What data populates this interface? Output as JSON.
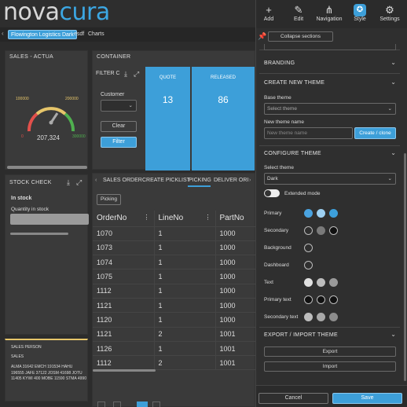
{
  "app": {
    "logo_part1": "nova",
    "logo_part2": "cura"
  },
  "navbar": {
    "chip1": "Flowington Logistics Dark",
    "chip2": "esdf",
    "chip3": "Charts"
  },
  "sales": {
    "title": "SALES - ACTUA",
    "min": "0",
    "low": "100000",
    "high": "200000",
    "max": "300000",
    "value": "207,324"
  },
  "container": {
    "title": "CONTAINER",
    "filter_label": "FILTER C",
    "customer_label": "Customer",
    "clear": "Clear",
    "filter": "Filter",
    "quote_label": "QUOTE",
    "quote_value": "13",
    "released_label": "RELEASED",
    "released_value": "86"
  },
  "stock": {
    "title": "STOCK CHECK",
    "in_stock": "In stock",
    "qty_label": "Quantity in stock"
  },
  "salesperson": {
    "title": "SALES PERSON",
    "sub": "SALES",
    "text": "ALMA 31642 EMCH 191534 HAHU 196555 JAFE 37122 JOSM 41698 JOTU 11405 KYWI 400 MOBE 11590 STMA 4990"
  },
  "grid": {
    "tabs": [
      "SALES ORDER",
      "CREATE PICKLIST",
      "PICKING",
      "DELIVER ORI"
    ],
    "active_tab": "PICKING",
    "picking_btn": "Picking",
    "columns": [
      "OrderNo",
      "LineNo",
      "PartNo"
    ],
    "rows": [
      [
        "1070",
        "1",
        "1000"
      ],
      [
        "1073",
        "1",
        "1000"
      ],
      [
        "1074",
        "1",
        "1000"
      ],
      [
        "1075",
        "1",
        "1000"
      ],
      [
        "1112",
        "1",
        "1000"
      ],
      [
        "1121",
        "1",
        "1000"
      ],
      [
        "1120",
        "1",
        "1000"
      ],
      [
        "1121",
        "2",
        "1001"
      ],
      [
        "1126",
        "1",
        "1001"
      ],
      [
        "1112",
        "2",
        "1001"
      ]
    ]
  },
  "toolbar": {
    "add": "Add",
    "edit": "Edit",
    "navigation": "Navigation",
    "style": "Style",
    "settings": "Settings"
  },
  "theme": {
    "collapse": "Collapse sections",
    "branding": "BRANDING",
    "create_title": "CREATE NEW THEME",
    "base_theme_label": "Base theme",
    "base_theme_placeholder": "Select theme",
    "new_name_label": "New theme name",
    "new_name_placeholder": "New theme name",
    "create_clone": "Create / clone",
    "configure_title": "CONFIGURE THEME",
    "select_theme_label": "Select theme",
    "select_theme_value": "Dark",
    "extended_mode": "Extended mode",
    "primary": "Primary",
    "secondary": "Secondary",
    "background": "Background",
    "dashboard": "Dashboard",
    "text": "Text",
    "primary_text": "Primary text",
    "secondary_text": "Secondary text",
    "export_title": "EXPORT / IMPORT THEME",
    "export": "Export",
    "import": "Import",
    "cancel": "Cancel",
    "save": "Save"
  },
  "colors": {
    "accent": "#3d9fd9",
    "primary_swatches": [
      "#4aa3e0",
      "#9dd0f2",
      "#3da0dc"
    ],
    "secondary_swatches": [
      "#2f2f2f",
      "#7a7a7a",
      "#111111"
    ],
    "text_swatches": [
      "#e0e0e0",
      "#bdbdbd",
      "#9a9a9a"
    ],
    "primary_text_swatches": [
      "#111111",
      "#111111",
      "#111111"
    ],
    "secondary_text_swatches": [
      "#bdbdbd",
      "#a8a8a8",
      "#8c8c8c"
    ]
  }
}
